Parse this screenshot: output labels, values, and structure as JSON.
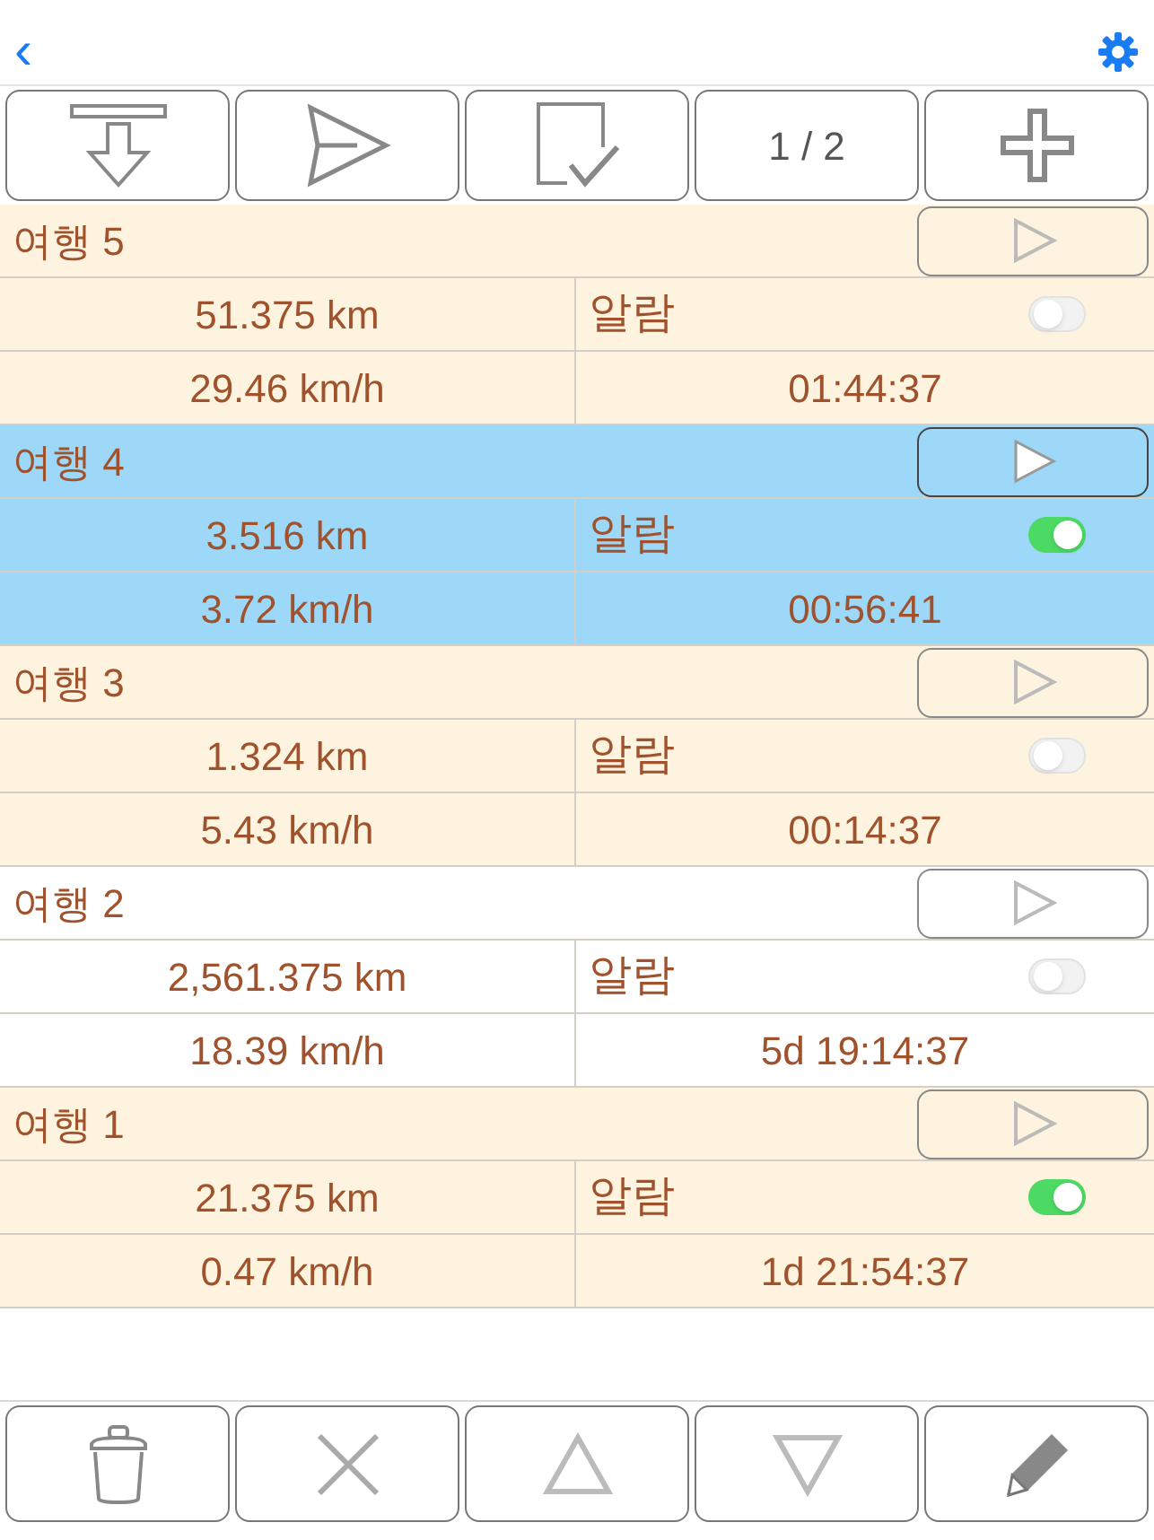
{
  "nav": {
    "back": "‹"
  },
  "toolbar": {
    "page": "1 / 2"
  },
  "trips": [
    {
      "name": "여행 5",
      "distance": "51.375 km",
      "alarm_label": "알람",
      "alarm": false,
      "speed": "29.46 km/h",
      "duration": "01:44:37",
      "selected": false
    },
    {
      "name": "여행 4",
      "distance": "3.516 km",
      "alarm_label": "알람",
      "alarm": true,
      "speed": "3.72 km/h",
      "duration": "00:56:41",
      "selected": true
    },
    {
      "name": "여행 3",
      "distance": "1.324 km",
      "alarm_label": "알람",
      "alarm": false,
      "speed": "5.43 km/h",
      "duration": "00:14:37",
      "selected": false
    },
    {
      "name": "여행 2",
      "distance": "2,561.375 km",
      "alarm_label": "알람",
      "alarm": false,
      "speed": "18.39 km/h",
      "duration": "5d 19:14:37",
      "selected": false
    },
    {
      "name": "여행 1",
      "distance": "21.375 km",
      "alarm_label": "알람",
      "alarm": true,
      "speed": "0.47 km/h",
      "duration": "1d 21:54:37",
      "selected": false
    }
  ]
}
